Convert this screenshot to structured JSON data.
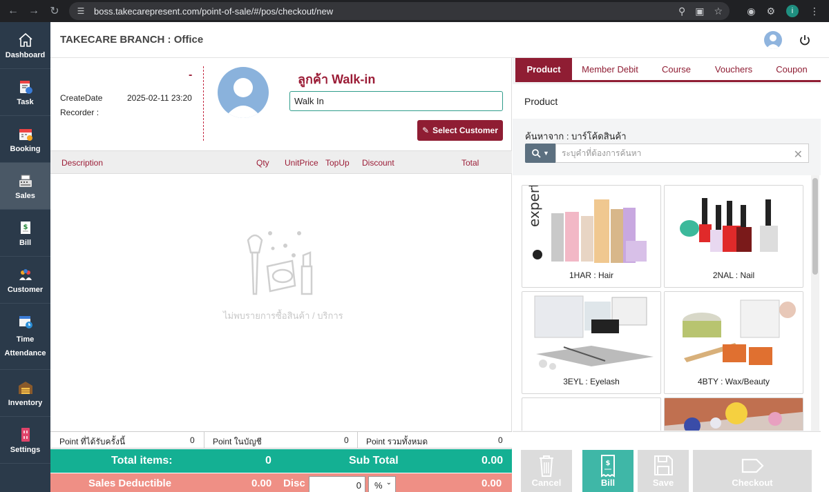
{
  "browser": {
    "url": "boss.takecarepresent.com/point-of-sale/#/pos/checkout/new",
    "profile_initial": "i"
  },
  "sidebar": {
    "items": [
      {
        "label": "Dashboard",
        "icon": "home-icon"
      },
      {
        "label": "Task",
        "icon": "task-icon"
      },
      {
        "label": "Booking",
        "icon": "calendar-icon"
      },
      {
        "label": "Sales",
        "icon": "cash-register-icon"
      },
      {
        "label": "Bill",
        "icon": "bill-icon"
      },
      {
        "label": "Customer",
        "icon": "customers-icon"
      },
      {
        "label": "Time Attendance",
        "icon": "clock-calendar-icon"
      },
      {
        "label": "Inventory",
        "icon": "warehouse-icon"
      },
      {
        "label": "Settings",
        "icon": "settings-icon"
      }
    ],
    "active": "Sales"
  },
  "header": {
    "branch": "TAKECARE BRANCH : Office"
  },
  "bill": {
    "number": "-",
    "create_date_label": "CreateDate",
    "create_date": "2025-02-11 23:20",
    "recorder_label": "Recorder :",
    "customer_title": "ลูกค้า Walk-in",
    "customer_name": "Walk In",
    "select_customer_label": "Select Customer"
  },
  "table": {
    "columns": [
      "Description",
      "Qty",
      "UnitPrice",
      "TopUp",
      "Discount",
      "Total"
    ],
    "empty_text": "ไม่พบรายการซื้อสินค้า / บริการ"
  },
  "points": {
    "earned_label": "Point ที่ได้รับครั้งนี้",
    "earned": "0",
    "account_label": "Point ในบัญชี",
    "account": "0",
    "total_label": "Point รวมทั้งหมด",
    "total": "0"
  },
  "totals": {
    "total_items_label": "Total items:",
    "total_items": "0",
    "sub_total_label": "Sub Total",
    "sub_total": "0.00",
    "sales_deductible_label": "Sales Deductible",
    "sales_deductible": "0.00",
    "disc_label": "Disc",
    "disc_value": "0",
    "disc_unit": "%",
    "disc_total": "0.00"
  },
  "right": {
    "tabs": [
      "Product",
      "Member Debit",
      "Course",
      "Vouchers",
      "Coupon"
    ],
    "active_tab": "Product",
    "section_title": "Product",
    "search_label": "ค้นหาจาก : บาร์โค้ดสินค้า",
    "search_placeholder": "ระบุคำที่ต้องการค้นหา",
    "products": [
      {
        "label": "1HAR : Hair"
      },
      {
        "label": "2NAL : Nail"
      },
      {
        "label": "3EYL : Eyelash"
      },
      {
        "label": "4BTY : Wax/Beauty"
      },
      {
        "label": ""
      },
      {
        "label": ""
      }
    ],
    "actions": [
      "Cancel",
      "Bill",
      "Save",
      "Checkout"
    ]
  },
  "colors": {
    "brand": "#8f1d33",
    "teal": "#14b093",
    "salmon": "#ef8f85",
    "sidebar": "#2b3a4a"
  }
}
